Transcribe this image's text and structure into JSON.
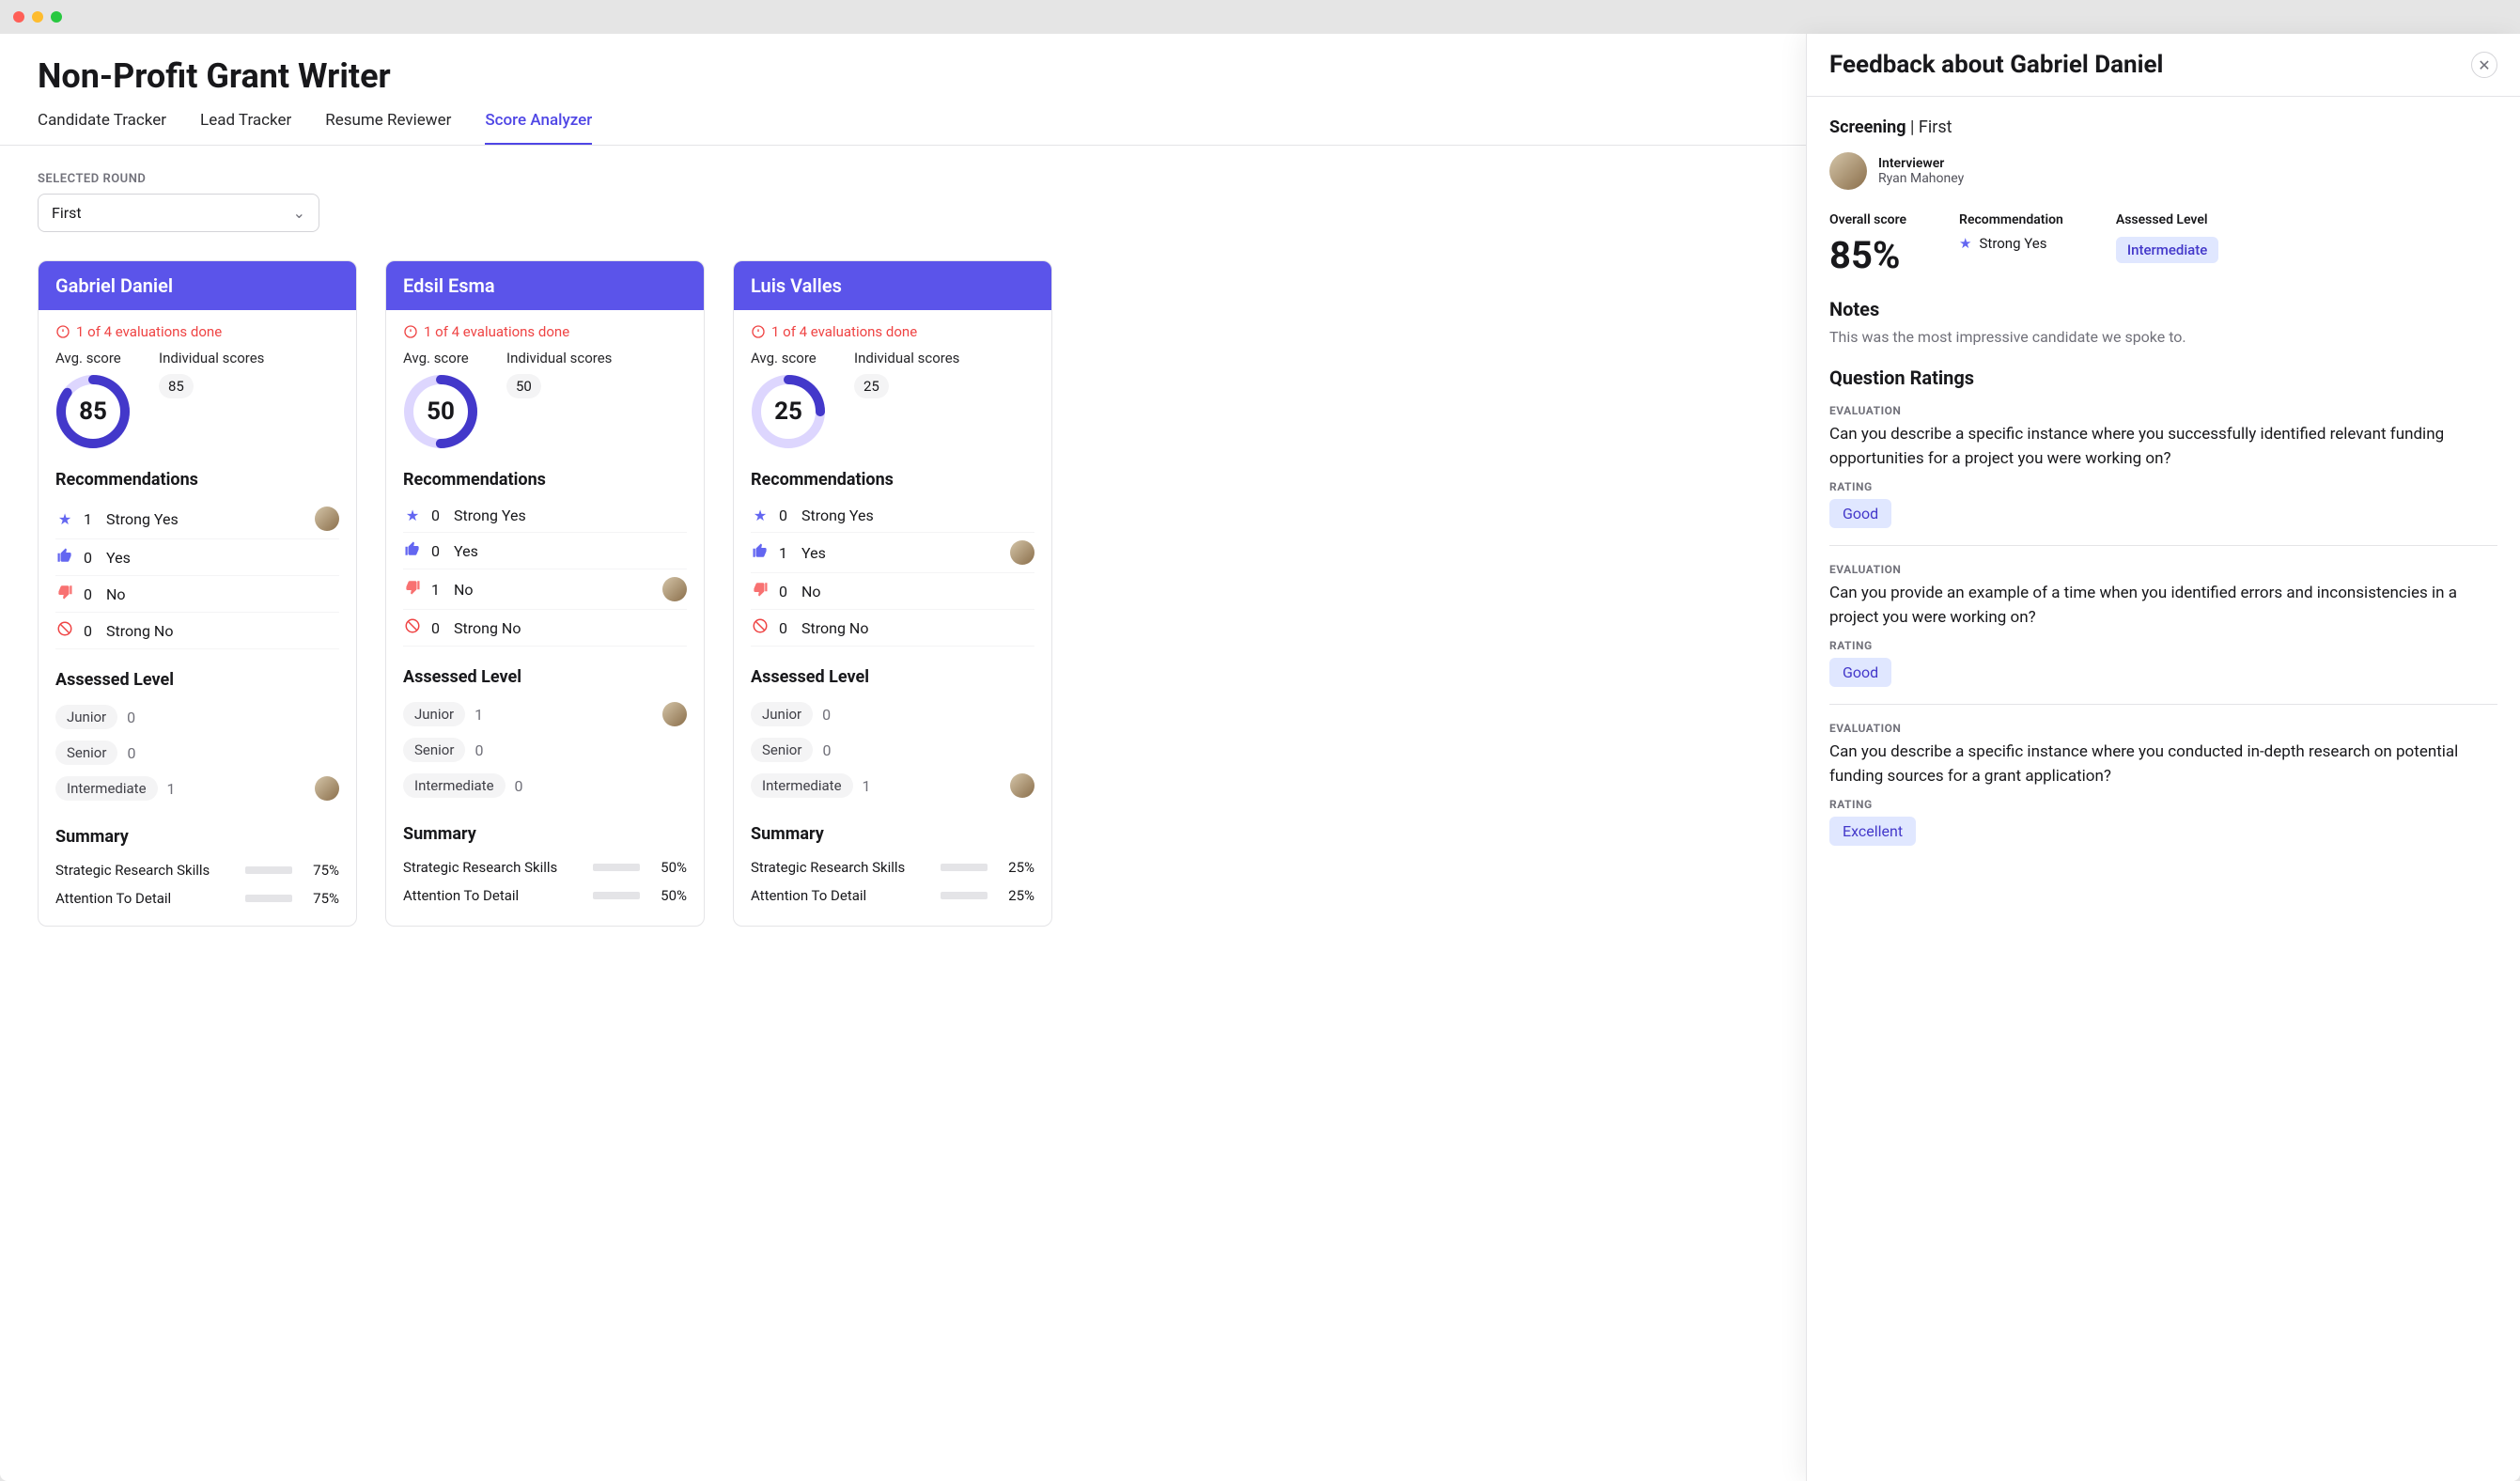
{
  "title": "Non-Profit Grant Writer",
  "tabs": [
    "Candidate Tracker",
    "Lead Tracker",
    "Resume Reviewer",
    "Score Analyzer"
  ],
  "active_tab": 3,
  "selected_round_label": "SELECTED ROUND",
  "selected_round_value": "First",
  "section_labels": {
    "avg_score": "Avg. score",
    "ind_scores": "Individual scores",
    "recommendations": "Recommendations",
    "assessed_level": "Assessed Level",
    "summary": "Summary"
  },
  "rec_labels": {
    "strong_yes": "Strong Yes",
    "yes": "Yes",
    "no": "No",
    "strong_no": "Strong No"
  },
  "level_labels": {
    "junior": "Junior",
    "senior": "Senior",
    "intermediate": "Intermediate"
  },
  "summary_labels": {
    "srs": "Strategic Research Skills",
    "atd": "Attention To Detail"
  },
  "candidates": [
    {
      "name": "Gabriel Daniel",
      "eval_status": "1 of 4 evaluations done",
      "avg": 85,
      "ind": "85",
      "recs": {
        "strong_yes": 1,
        "yes": 0,
        "no": 0,
        "strong_no": 0
      },
      "rec_avatar": "strong_yes",
      "levels": {
        "junior": 0,
        "senior": 0,
        "intermediate": 1
      },
      "level_avatar": "intermediate",
      "summary": [
        {
          "k": "srs",
          "pct": 75
        },
        {
          "k": "atd",
          "pct": 75
        }
      ]
    },
    {
      "name": "Edsil Esma",
      "eval_status": "1 of 4 evaluations done",
      "avg": 50,
      "ind": "50",
      "recs": {
        "strong_yes": 0,
        "yes": 0,
        "no": 1,
        "strong_no": 0
      },
      "rec_avatar": "no",
      "levels": {
        "junior": 1,
        "senior": 0,
        "intermediate": 0
      },
      "level_avatar": "junior",
      "summary": [
        {
          "k": "srs",
          "pct": 50
        },
        {
          "k": "atd",
          "pct": 50
        }
      ]
    },
    {
      "name": "Luis Valles",
      "eval_status": "1 of 4 evaluations done",
      "avg": 25,
      "ind": "25",
      "recs": {
        "strong_yes": 0,
        "yes": 1,
        "no": 0,
        "strong_no": 0
      },
      "rec_avatar": "yes",
      "levels": {
        "junior": 0,
        "senior": 0,
        "intermediate": 1
      },
      "level_avatar": "intermediate",
      "summary": [
        {
          "k": "srs",
          "pct": 25
        },
        {
          "k": "atd",
          "pct": 25
        }
      ]
    }
  ],
  "drawer": {
    "title": "Feedback about Gabriel Daniel",
    "screening_label": "Screening",
    "screening_round": "First",
    "interviewer_role": "Interviewer",
    "interviewer_name": "Ryan Mahoney",
    "overall_label": "Overall score",
    "overall_value": "85%",
    "rec_label": "Recommendation",
    "rec_value": "Strong Yes",
    "assessed_label": "Assessed Level",
    "assessed_value": "Intermediate",
    "notes_h": "Notes",
    "notes_text": "This was the most impressive candidate we spoke to.",
    "qr_h": "Question Ratings",
    "eval_label": "EVALUATION",
    "rating_label": "RATING",
    "questions": [
      {
        "text": "Can you describe a specific instance where you successfully identified relevant funding opportunities for a project you were working on?",
        "rating": "Good"
      },
      {
        "text": "Can you provide an example of a time when you identified errors and inconsistencies in a project you were working on?",
        "rating": "Good"
      },
      {
        "text": "Can you describe a specific instance where you conducted in-depth research on potential funding sources for a grant application?",
        "rating": "Excellent"
      }
    ]
  }
}
